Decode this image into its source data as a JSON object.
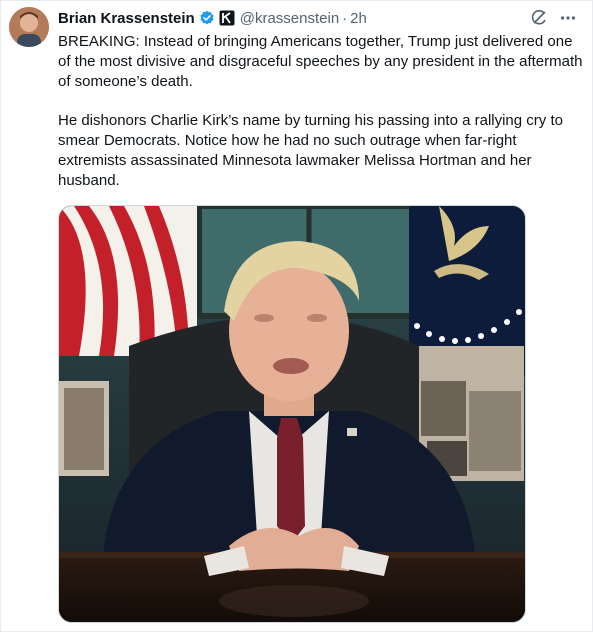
{
  "author": {
    "display_name": "Brian Krassenstein",
    "handle": "@krassenstein",
    "separator": "·",
    "timestamp": "2h"
  },
  "tweet": {
    "paragraph_1": "BREAKING: Instead of bringing Americans together, Trump just delivered one of the most divisive and disgraceful speeches by any president in the aftermath of someone’s death.",
    "paragraph_2": "He dishonors Charlie Kirk’s name by turning his passing into a rallying cry to smear Democrats. Notice how he had no such outrage when far-right extremists assassinated Minnesota lawmaker Melissa Hortman and her husband."
  },
  "icons": {
    "verified": "verified-badge-icon",
    "affiliation": "affiliate-logo-icon",
    "grok": "grok-icon",
    "more": "more-options-icon"
  },
  "colors": {
    "text": "#0f1419",
    "secondary": "#536471",
    "verified_blue": "#1d9bf0"
  }
}
